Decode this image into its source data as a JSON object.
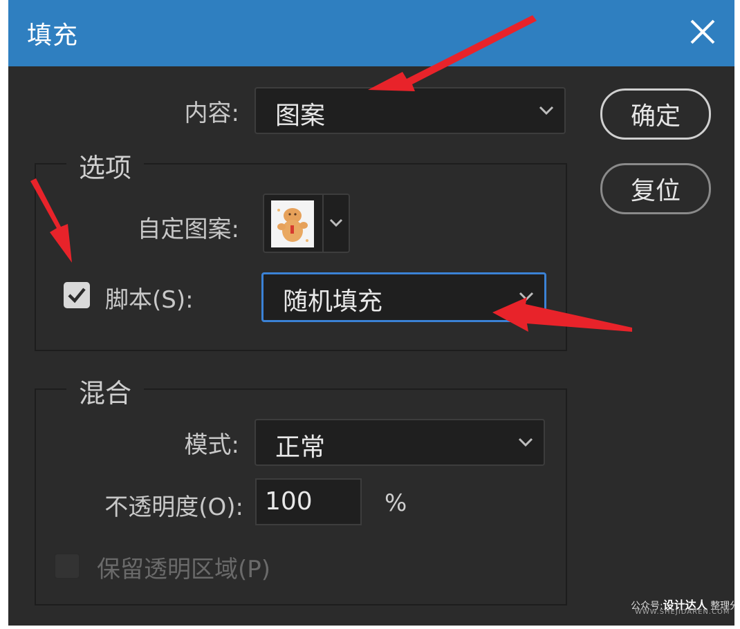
{
  "dialog": {
    "title": "填充",
    "close_icon": "close-icon"
  },
  "content": {
    "label": "内容:",
    "value": "图案"
  },
  "buttons": {
    "ok": "确定",
    "reset": "复位"
  },
  "options_group": {
    "title": "选项",
    "custom_pattern_label": "自定图案:",
    "script_checked": true,
    "script_label": "脚本(S):",
    "script_value": "随机填充"
  },
  "blend_group": {
    "title": "混合",
    "mode_label": "模式:",
    "mode_value": "正常",
    "opacity_label": "不透明度(O):",
    "opacity_value": "100",
    "opacity_unit": "%",
    "preserve_checked": false,
    "preserve_label": "保留透明区域(P)"
  },
  "watermark": {
    "line1_prefix": "公众号:",
    "line1_brand": "设计达人",
    "line1_suffix": "整理分享",
    "line2": "WWW.SHEJIDAREN.COM"
  },
  "colors": {
    "titlebar": "#2f7fc0",
    "dialog_bg": "#2b2b2b",
    "focus_border": "#3b82d6",
    "annotation_arrow": "#e8232a"
  }
}
